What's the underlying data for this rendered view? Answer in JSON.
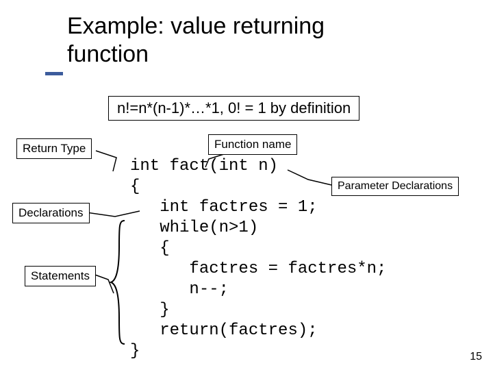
{
  "title_line1": "Example: value returning",
  "title_line2": "function",
  "formula": "n!=n*(n-1)*…*1, 0! = 1 by definition",
  "labels": {
    "return_type": "Return Type",
    "function_name": "Function name",
    "parameter_decl": "Parameter Declarations",
    "declarations": "Declarations",
    "statements": "Statements"
  },
  "code": "int fact(int n)\n{\n   int factres = 1;\n   while(n>1)\n   {\n      factres = factres*n;\n      n--;\n   }\n   return(factres);\n}",
  "page_number": "15"
}
